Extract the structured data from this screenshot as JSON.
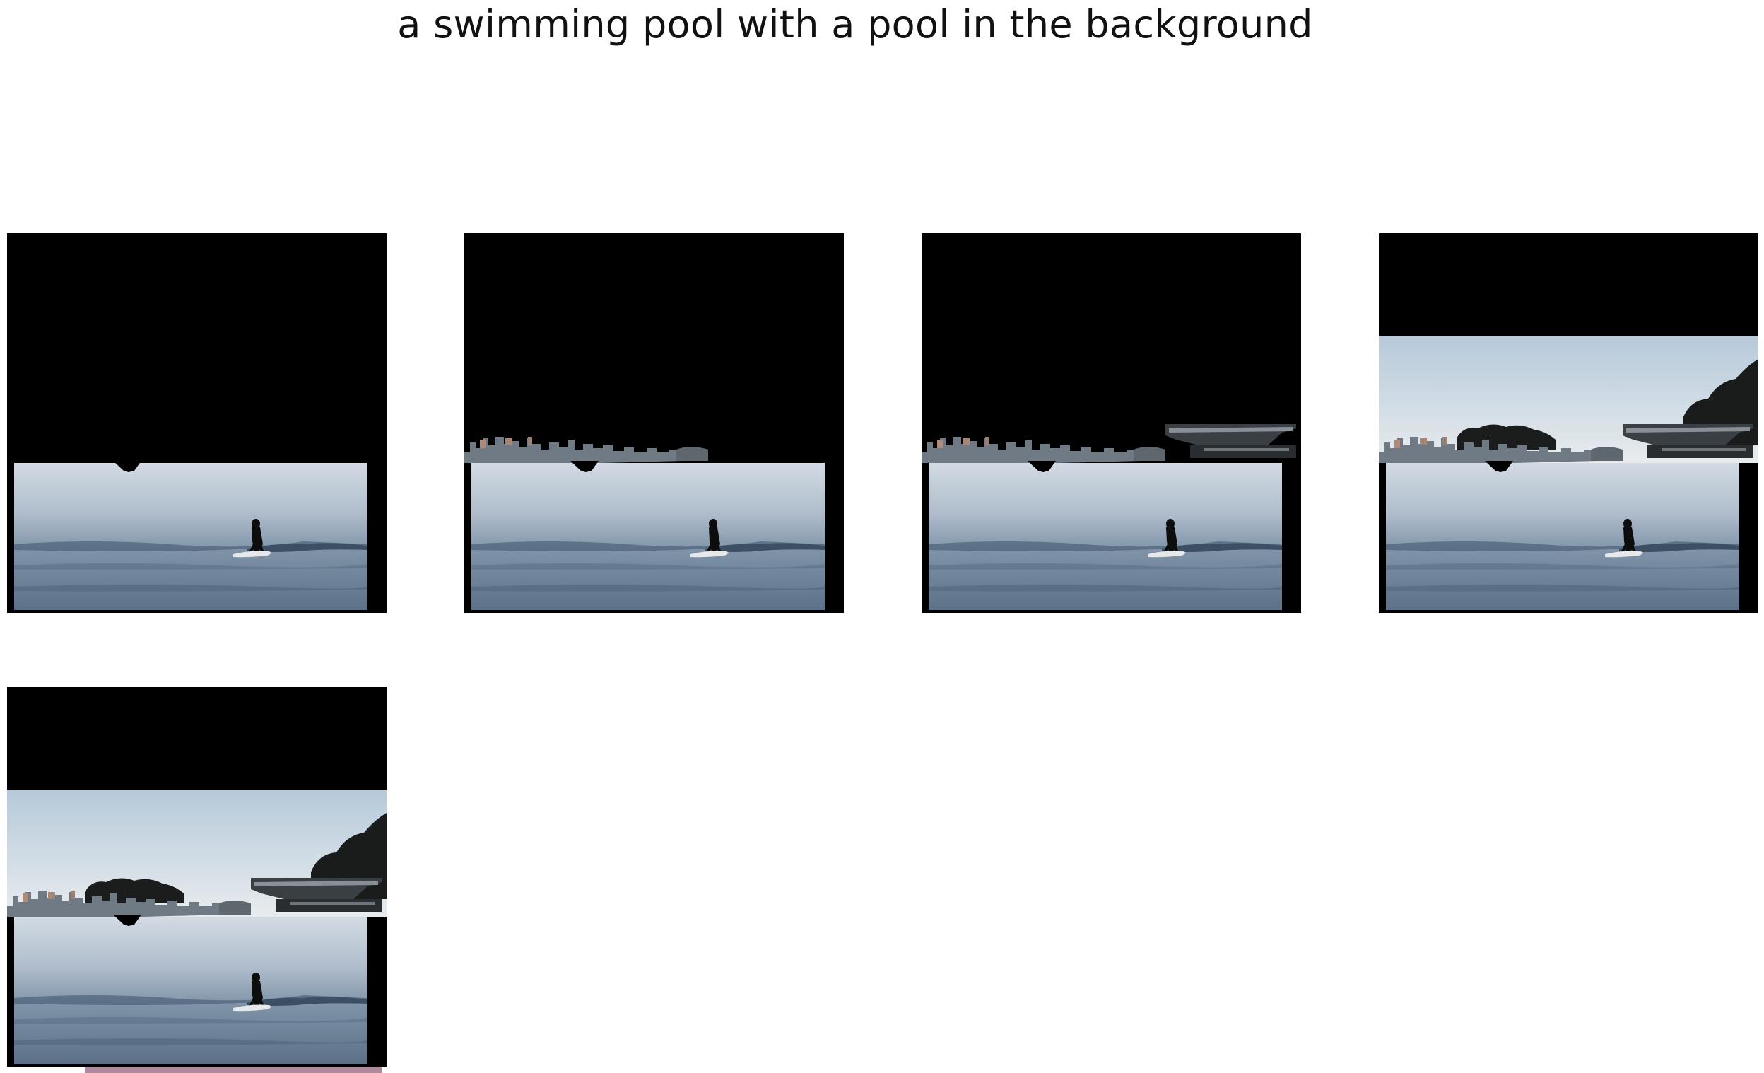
{
  "figure": {
    "title": "a swimming pool with a pool in the background",
    "panels": [
      {
        "stage": 1,
        "reveals": [
          "water",
          "surfer"
        ]
      },
      {
        "stage": 2,
        "reveals": [
          "water",
          "surfer",
          "city-skyline"
        ]
      },
      {
        "stage": 3,
        "reveals": [
          "water",
          "surfer",
          "city-skyline",
          "pier"
        ]
      },
      {
        "stage": 4,
        "reveals": [
          "water",
          "surfer",
          "city-skyline",
          "pier",
          "sky",
          "trees"
        ]
      },
      {
        "stage": 5,
        "reveals": [
          "water",
          "surfer",
          "city-skyline",
          "pier",
          "sky",
          "trees"
        ]
      }
    ]
  },
  "colors": {
    "background": "#ffffff",
    "mask": "#000000",
    "water_light": "#c9d3de",
    "water_dark": "#4a5f75",
    "sky_top": "#b8cbdc",
    "sky_bottom": "#e6ecef",
    "skyline": "#6e7780",
    "trees": "#1a1c1b"
  }
}
